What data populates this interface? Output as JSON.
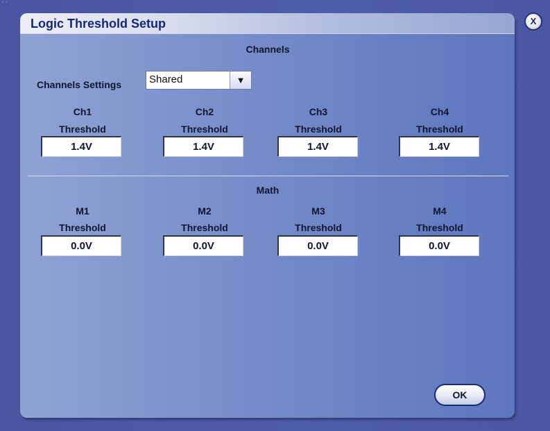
{
  "window": {
    "title": "Logic Threshold Setup",
    "close_label": "X",
    "ok_label": "OK"
  },
  "channels": {
    "section_title": "Channels",
    "settings_label": "Channels Settings",
    "settings_value": "Shared",
    "items": [
      {
        "name": "Ch1",
        "label": "Threshold",
        "value": "1.4V"
      },
      {
        "name": "Ch2",
        "label": "Threshold",
        "value": "1.4V"
      },
      {
        "name": "Ch3",
        "label": "Threshold",
        "value": "1.4V"
      },
      {
        "name": "Ch4",
        "label": "Threshold",
        "value": "1.4V"
      }
    ]
  },
  "math": {
    "section_title": "Math",
    "items": [
      {
        "name": "M1",
        "label": "Threshold",
        "value": "0.0V"
      },
      {
        "name": "M2",
        "label": "Threshold",
        "value": "0.0V"
      },
      {
        "name": "M3",
        "label": "Threshold",
        "value": "0.0V"
      },
      {
        "name": "M4",
        "label": "Threshold",
        "value": "0.0V"
      }
    ]
  },
  "colors": {
    "title_text": "#16277a",
    "panel_start": "#8fa3d3",
    "panel_end": "#5d76bd",
    "outer_background": "#4c5aa5"
  },
  "icons": {
    "close": "close-icon",
    "dropdown": "chevron-down-icon",
    "grip": "resize-grip-icon"
  }
}
